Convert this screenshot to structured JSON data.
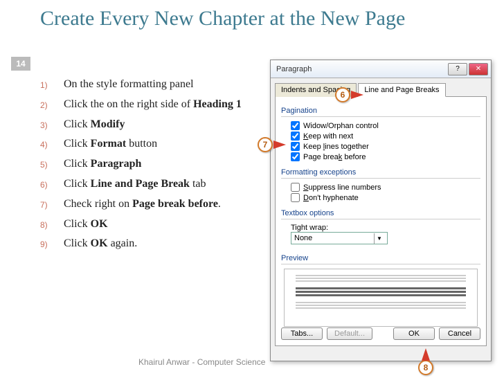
{
  "title": "Create Every New Chapter at the New Page",
  "page_number": "14",
  "footer": "Khairul Anwar - Computer Science",
  "steps": [
    {
      "n": "1)",
      "html": "On the style formatting panel"
    },
    {
      "n": "2)",
      "html": "Click the on the right side of <b>Heading 1</b>"
    },
    {
      "n": "3)",
      "html": "Click <b>Modify</b>"
    },
    {
      "n": "4)",
      "html": "Click <b>Format</b> button"
    },
    {
      "n": "5)",
      "html": "Click <b>Paragraph</b>"
    },
    {
      "n": "6)",
      "html": "Click <b>Line and Page Break</b> tab"
    },
    {
      "n": "7)",
      "html": "Check right on <b>Page break before</b>."
    },
    {
      "n": "8)",
      "html": "Click <b>OK</b>"
    },
    {
      "n": "9)",
      "html": "Click <b>OK</b> again."
    }
  ],
  "dialog": {
    "title": "Paragraph",
    "tabs": {
      "indents": "Indents and Spacing",
      "line": "Line and Page Breaks"
    },
    "groups": {
      "pagination": "Pagination",
      "exceptions": "Formatting exceptions",
      "textbox": "Textbox options",
      "preview": "Preview"
    },
    "checks": {
      "widow": "Widow/Orphan control",
      "keepnext": "Keep with next",
      "keeplines": "Keep lines together",
      "pagebreak": "Page break before",
      "suppress": "Suppress line numbers",
      "hyphen": "Don't hyphenate"
    },
    "tightwrap_label": "Tight wrap:",
    "tightwrap_value": "None",
    "buttons": {
      "tabs": "Tabs...",
      "default": "Default...",
      "ok": "OK",
      "cancel": "Cancel"
    }
  },
  "callouts": {
    "c6": "6",
    "c7": "7",
    "c8": "8"
  }
}
